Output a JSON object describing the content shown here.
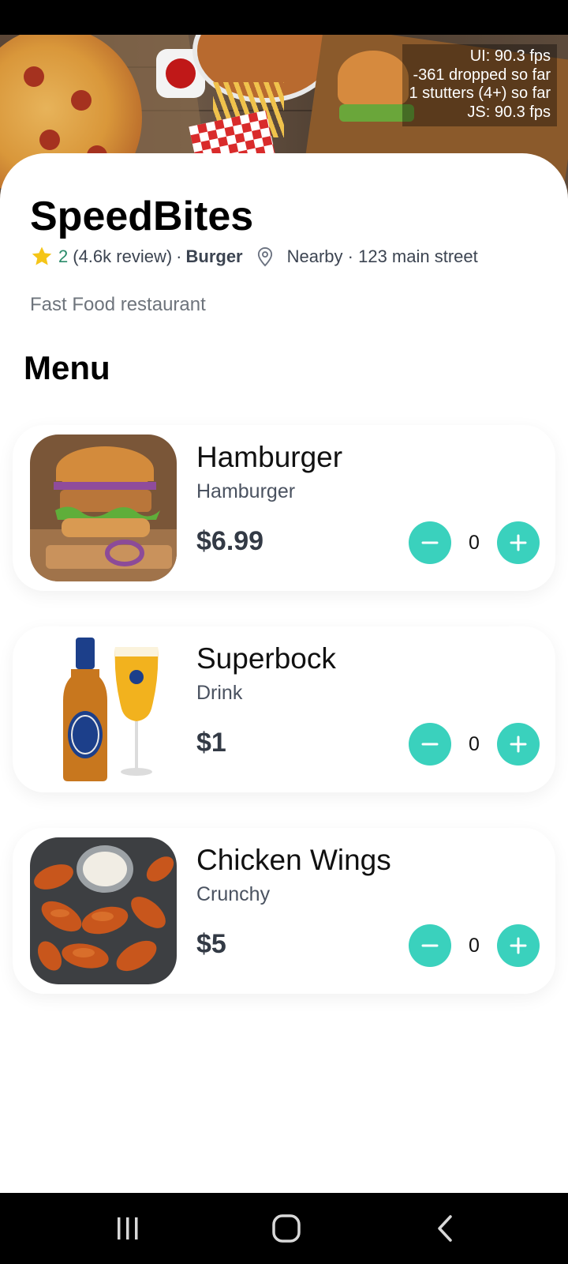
{
  "perf_overlay": {
    "ui_fps": "UI: 90.3 fps",
    "dropped": "-361 dropped so far",
    "stutters": "1 stutters (4+) so far",
    "js_fps": "JS: 90.3 fps"
  },
  "restaurant": {
    "name": "SpeedBites",
    "rating": "2",
    "reviews": "(4.6k review)",
    "separator": "·",
    "category": "Burger",
    "location": "Nearby · 123 main street",
    "type": "Fast Food restaurant"
  },
  "menu": {
    "title": "Menu",
    "items": [
      {
        "name": "Hamburger",
        "description": "Hamburger",
        "price": "$6.99",
        "quantity": "0"
      },
      {
        "name": "Superbock",
        "description": "Drink",
        "price": "$1",
        "quantity": "0"
      },
      {
        "name": "Chicken Wings",
        "description": "Crunchy",
        "price": "$5",
        "quantity": "0"
      }
    ]
  },
  "colors": {
    "accent": "#3ad1bd",
    "star": "#f5c518",
    "rating_text": "#2a8b6a"
  },
  "icons": {
    "rating": "star-icon",
    "location": "location-pin-icon",
    "decrement": "minus-icon",
    "increment": "plus-icon",
    "nav_recents": "recent-apps-icon",
    "nav_home": "home-icon",
    "nav_back": "back-icon"
  }
}
